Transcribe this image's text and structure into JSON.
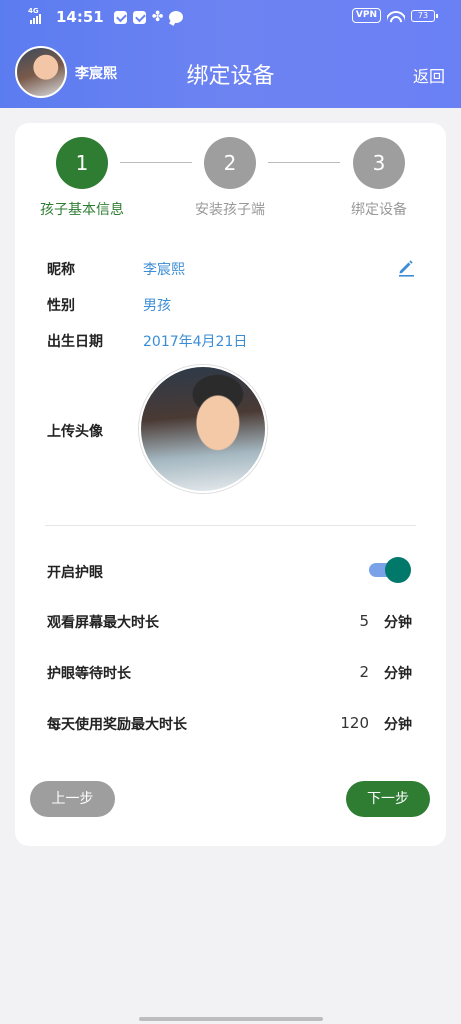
{
  "status_bar": {
    "network": "4G",
    "time": "14:51",
    "vpn": "VPN",
    "battery": "73"
  },
  "header": {
    "user_name": "李宸熙",
    "title": "绑定设备",
    "back_label": "返回"
  },
  "steps": [
    {
      "number": "1",
      "label": "孩子基本信息",
      "active": true
    },
    {
      "number": "2",
      "label": "安装孩子端",
      "active": false
    },
    {
      "number": "3",
      "label": "绑定设备",
      "active": false
    }
  ],
  "profile": {
    "nickname_label": "昵称",
    "nickname_value": "李宸熙",
    "gender_label": "性别",
    "gender_value": "男孩",
    "birthday_label": "出生日期",
    "birthday_value": "2017年4月21日",
    "avatar_label": "上传头像"
  },
  "settings": {
    "eye_protect_label": "开启护眼",
    "eye_protect_on": true,
    "max_screen_label": "观看屏幕最大时长",
    "max_screen_value": "5",
    "wait_label": "护眼等待时长",
    "wait_value": "2",
    "reward_label": "每天使用奖励最大时长",
    "reward_value": "120",
    "unit": "分钟"
  },
  "buttons": {
    "prev": "上一步",
    "next": "下一步"
  },
  "colors": {
    "header_gradient_start": "#5b7cf0",
    "active_step": "#2e7d32",
    "inactive_step": "#9e9e9e",
    "value_blue": "#3b8ed6",
    "toggle_thumb": "#00796b"
  }
}
